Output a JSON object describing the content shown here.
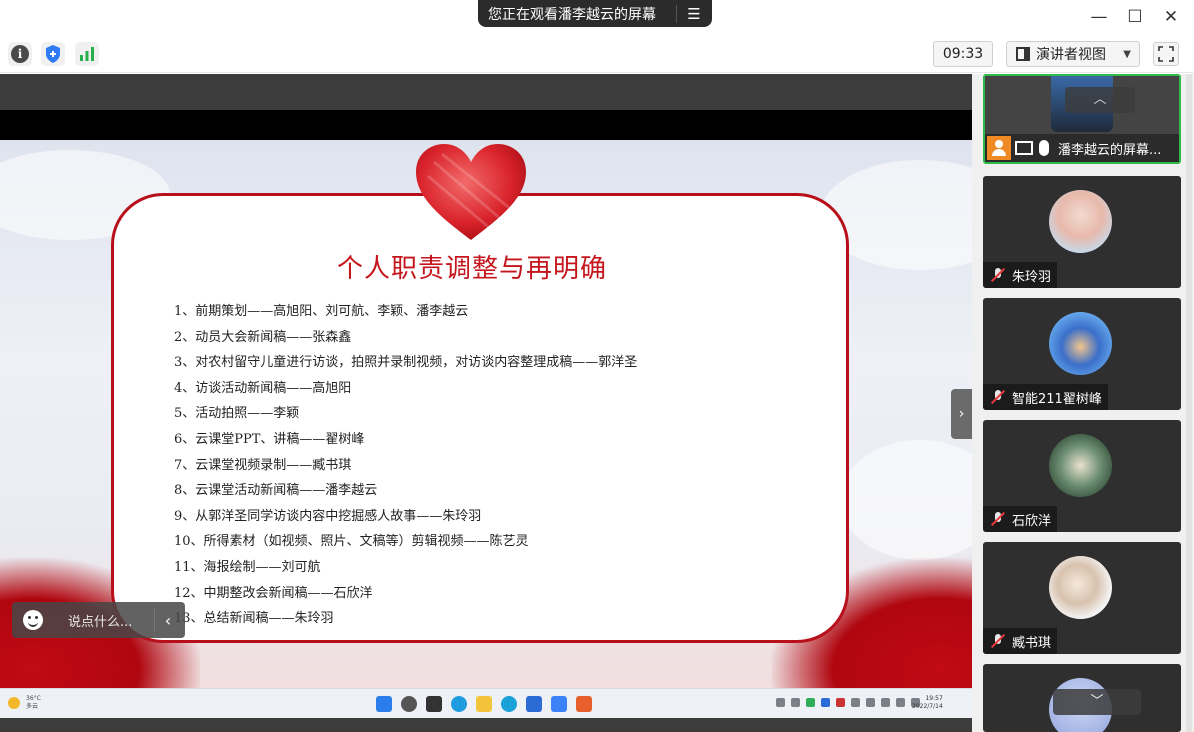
{
  "window": {
    "share_notice": "您正在观看潘李越云的屏幕",
    "share_menu_icon": "list-menu-icon",
    "minimize_icon": "minimize-icon",
    "maximize_icon": "maximize-icon",
    "close_icon": "close-icon"
  },
  "toolbar": {
    "timer": "09:33",
    "view_mode": "演讲者视图",
    "icons": [
      "info-icon",
      "shield-icon",
      "signal-icon",
      "fullscreen-icon"
    ],
    "shield_color": "#2f7bf5",
    "signal_color": "#27b04a"
  },
  "slide": {
    "title": "个人职责调整与再明确",
    "items": [
      "1、前期策划——高旭阳、刘可航、李颖、潘李越云",
      "2、动员大会新闻稿——张森鑫",
      "3、对农村留守儿童进行访谈，拍照并录制视频，对访谈内容整理成稿——郭洋圣",
      "4、访谈活动新闻稿——高旭阳",
      "5、活动拍照——李颖",
      "6、云课堂PPT、讲稿——翟树峰",
      "7、云课堂视频录制——臧书琪",
      "8、云课堂活动新闻稿——潘李越云",
      "9、从郭洋圣同学访谈内容中挖掘感人故事——朱玲羽",
      "10、所得素材（如视频、照片、文稿等）剪辑视频——陈艺灵",
      "11、海报绘制——刘可航",
      "12、中期整改会新闻稿——石欣洋",
      "13、总结新闻稿——朱玲羽"
    ],
    "accent_color": "#c4161c"
  },
  "comment": {
    "placeholder": "说点什么..."
  },
  "taskbar": {
    "weather_temp": "36°C",
    "weather_desc": "多云",
    "clock_time": "19:57",
    "clock_date": "2022/7/14"
  },
  "participants": [
    {
      "name": "潘李越云的屏幕...",
      "role": "sharer"
    },
    {
      "name": "朱玲羽",
      "muted": true
    },
    {
      "name": "智能211翟树峰",
      "muted": true
    },
    {
      "name": "石欣洋",
      "muted": true
    },
    {
      "name": "臧书琪",
      "muted": true
    }
  ]
}
